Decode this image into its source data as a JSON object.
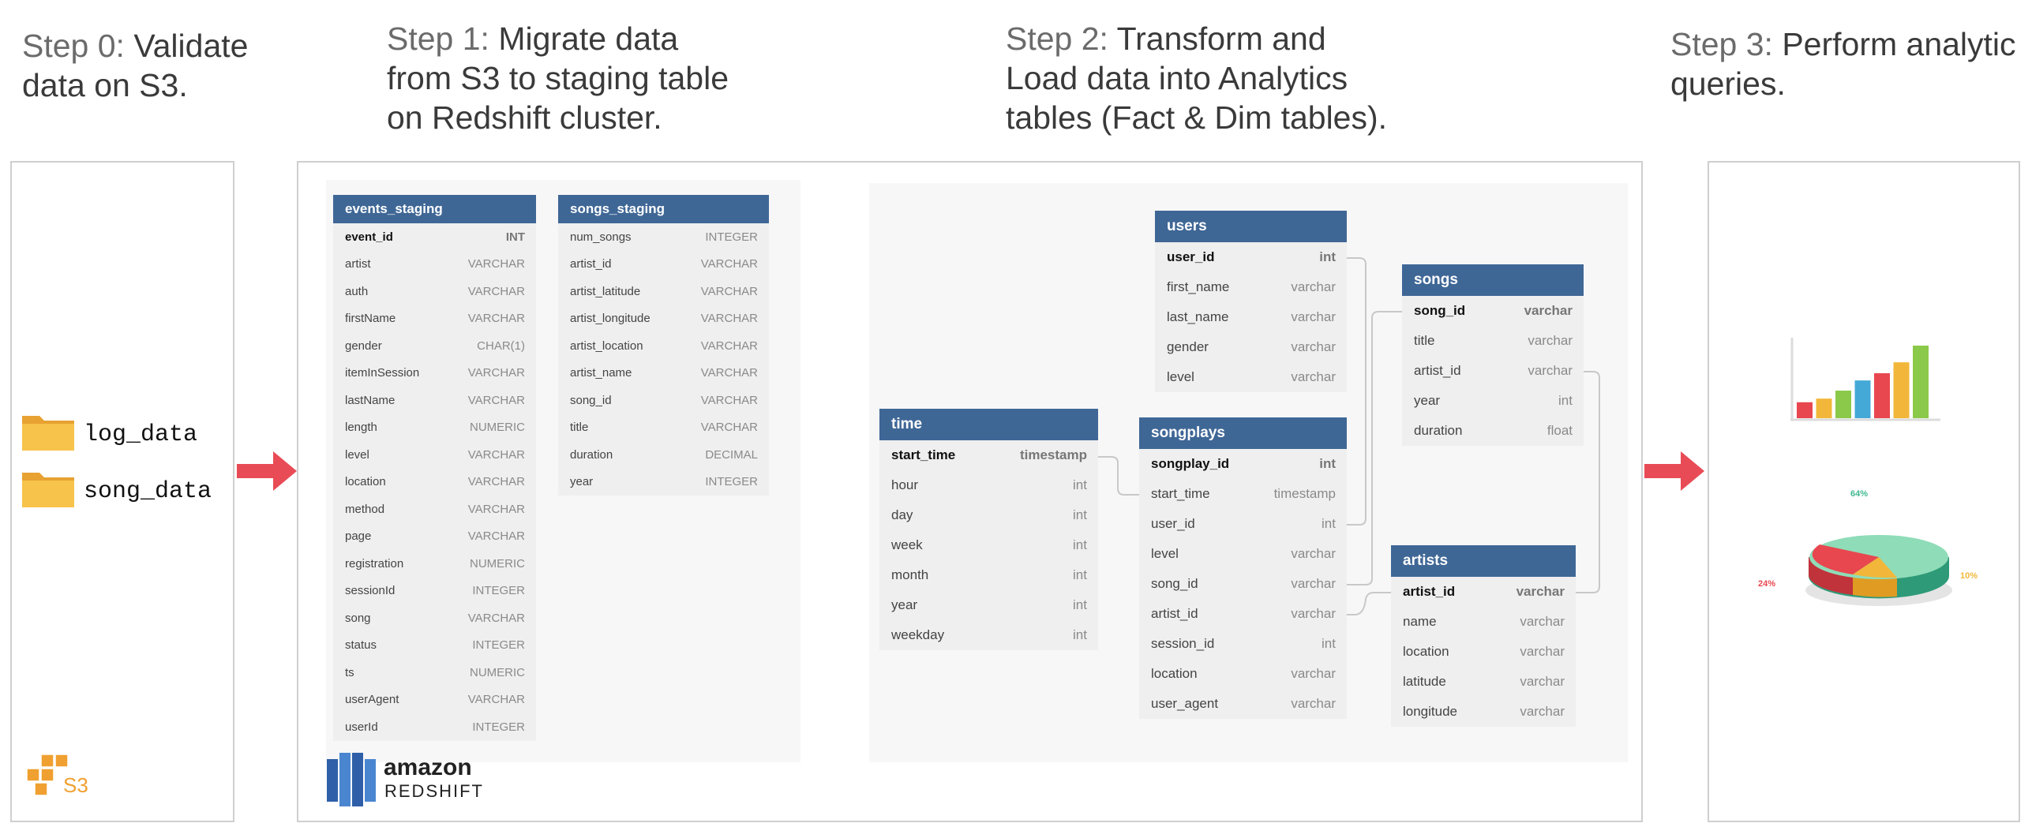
{
  "steps": {
    "step0": {
      "num": "Step 0:",
      "text": " Validate",
      "line2": "data on S3."
    },
    "step1": {
      "num": "Step 1:",
      "text": " Migrate data",
      "line2": "from S3 to staging table",
      "line3": "on Redshift cluster."
    },
    "step2": {
      "num": "Step 2:",
      "text": " Transform and",
      "line2": "Load data into Analytics",
      "line3": "tables (Fact & Dim tables)."
    },
    "step3": {
      "num": "Step 3:",
      "text": " Perform analytic",
      "line2": "queries."
    }
  },
  "s3": {
    "folders": [
      "log_data",
      "song_data"
    ],
    "logo_text": "S3"
  },
  "redshift": {
    "brand": "amazon",
    "product": "REDSHIFT"
  },
  "colors": {
    "header": "#3f6796",
    "arrow": "#e84b55",
    "folder": "#f5b43c"
  },
  "tables": {
    "events_staging": {
      "name": "events_staging",
      "columns": [
        {
          "name": "event_id",
          "type": "INT"
        },
        {
          "name": "artist",
          "type": "VARCHAR"
        },
        {
          "name": "auth",
          "type": "VARCHAR"
        },
        {
          "name": "firstName",
          "type": "VARCHAR"
        },
        {
          "name": "gender",
          "type": "CHAR(1)"
        },
        {
          "name": "itemInSession",
          "type": "VARCHAR"
        },
        {
          "name": "lastName",
          "type": "VARCHAR"
        },
        {
          "name": "length",
          "type": "NUMERIC"
        },
        {
          "name": "level",
          "type": "VARCHAR"
        },
        {
          "name": "location",
          "type": "VARCHAR"
        },
        {
          "name": "method",
          "type": "VARCHAR"
        },
        {
          "name": "page",
          "type": "VARCHAR"
        },
        {
          "name": "registration",
          "type": "NUMERIC"
        },
        {
          "name": "sessionId",
          "type": "INTEGER"
        },
        {
          "name": "song",
          "type": "VARCHAR"
        },
        {
          "name": "status",
          "type": "INTEGER"
        },
        {
          "name": "ts",
          "type": "NUMERIC"
        },
        {
          "name": "userAgent",
          "type": "VARCHAR"
        },
        {
          "name": "userId",
          "type": "INTEGER"
        }
      ]
    },
    "songs_staging": {
      "name": "songs_staging",
      "columns": [
        {
          "name": "num_songs",
          "type": "INTEGER"
        },
        {
          "name": "artist_id",
          "type": "VARCHAR"
        },
        {
          "name": "artist_latitude",
          "type": "VARCHAR"
        },
        {
          "name": "artist_longitude",
          "type": "VARCHAR"
        },
        {
          "name": "artist_location",
          "type": "VARCHAR"
        },
        {
          "name": "artist_name",
          "type": "VARCHAR"
        },
        {
          "name": "song_id",
          "type": "VARCHAR"
        },
        {
          "name": "title",
          "type": "VARCHAR"
        },
        {
          "name": "duration",
          "type": "DECIMAL"
        },
        {
          "name": "year",
          "type": "INTEGER"
        }
      ]
    },
    "time": {
      "name": "time",
      "columns": [
        {
          "name": "start_time",
          "type": "timestamp",
          "pk": true
        },
        {
          "name": "hour",
          "type": "int"
        },
        {
          "name": "day",
          "type": "int"
        },
        {
          "name": "week",
          "type": "int"
        },
        {
          "name": "month",
          "type": "int"
        },
        {
          "name": "year",
          "type": "int"
        },
        {
          "name": "weekday",
          "type": "int"
        }
      ]
    },
    "users": {
      "name": "users",
      "columns": [
        {
          "name": "user_id",
          "type": "int",
          "pk": true
        },
        {
          "name": "first_name",
          "type": "varchar"
        },
        {
          "name": "last_name",
          "type": "varchar"
        },
        {
          "name": "gender",
          "type": "varchar"
        },
        {
          "name": "level",
          "type": "varchar"
        }
      ]
    },
    "songplays": {
      "name": "songplays",
      "columns": [
        {
          "name": "songplay_id",
          "type": "int",
          "pk": true
        },
        {
          "name": "start_time",
          "type": "timestamp"
        },
        {
          "name": "user_id",
          "type": "int"
        },
        {
          "name": "level",
          "type": "varchar"
        },
        {
          "name": "song_id",
          "type": "varchar"
        },
        {
          "name": "artist_id",
          "type": "varchar"
        },
        {
          "name": "session_id",
          "type": "int"
        },
        {
          "name": "location",
          "type": "varchar"
        },
        {
          "name": "user_agent",
          "type": "varchar"
        }
      ]
    },
    "songs": {
      "name": "songs",
      "columns": [
        {
          "name": "song_id",
          "type": "varchar",
          "pk": true
        },
        {
          "name": "title",
          "type": "varchar"
        },
        {
          "name": "artist_id",
          "type": "varchar"
        },
        {
          "name": "year",
          "type": "int"
        },
        {
          "name": "duration",
          "type": "float"
        }
      ]
    },
    "artists": {
      "name": "artists",
      "columns": [
        {
          "name": "artist_id",
          "type": "varchar",
          "pk": true
        },
        {
          "name": "name",
          "type": "varchar"
        },
        {
          "name": "location",
          "type": "varchar"
        },
        {
          "name": "latitude",
          "type": "varchar"
        },
        {
          "name": "longitude",
          "type": "varchar"
        }
      ]
    }
  },
  "analytics": {
    "bar_colors": [
      "#e8474f",
      "#f2b73a",
      "#8bc94a",
      "#45a9d8",
      "#e8474f",
      "#f2b73a",
      "#8bc94a"
    ],
    "bar_levels": [
      0.22,
      0.27,
      0.38,
      0.52,
      0.62,
      0.77,
      1.0
    ],
    "pie": [
      {
        "label": "64%",
        "color": "#3fb88f"
      },
      {
        "label": "24%",
        "color": "#e8474f"
      },
      {
        "label": "10%",
        "color": "#f2b73a"
      }
    ]
  }
}
